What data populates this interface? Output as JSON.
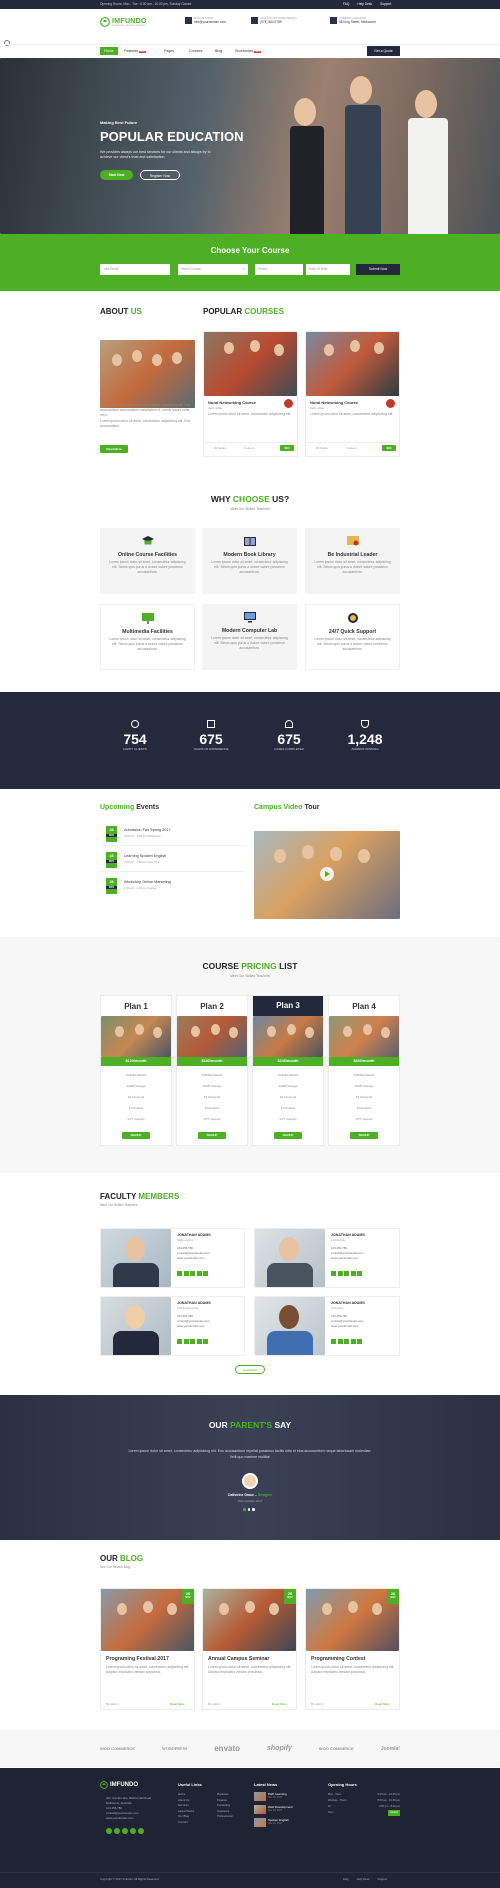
{
  "topbar": {
    "hours": "Opening Hours: Mon - Tue : 6.00 am - 10.00 pm, Sunday Closed",
    "links": [
      "FAQ",
      "Help Desk",
      "Support"
    ]
  },
  "header": {
    "logo": "IMFUNDO",
    "logo_tagline": "EDUCATIONAL UNIVERSITY TEMPLATE",
    "contact": [
      {
        "title": "MAIL US TODAY",
        "value": "info@yourdomain.com"
      },
      {
        "title": "CALL US FOR MORE DETAILS",
        "value": "(974) 564 9789"
      },
      {
        "title": "COMPANY LOCATION",
        "value": "58 King Street, Melbourne"
      }
    ]
  },
  "nav": {
    "items": [
      "Home",
      "Features",
      "Pages",
      "Courses",
      "Blog",
      "Shortcodes"
    ],
    "new_badge": "NEW",
    "cta": "Get a Quote"
  },
  "hero": {
    "kicker": "Making Best Future",
    "title": "POPULAR EDUCATION",
    "text": "We provides always our best services for our clients and always try to achieve our client's trust and satisfaction.",
    "btn1": "Start Now",
    "btn2": "Register Now"
  },
  "choose": {
    "title": "Choose Your Course",
    "fields": [
      "Your Email",
      "Select Course",
      "Phone",
      "Date Of Birth"
    ],
    "submit": "Submit Now"
  },
  "about": {
    "title_a": "ABOUT",
    "title_b": "US",
    "text": "Lorem ipsum dolor sit amet, consectetur adipisicing elit. Eos accusantium accusantium voluptatem ut, omnis ipsum nulla vero.",
    "text2": "Lorem ipsum dolor sit amet, consectetur adipisicing elit. Eos accusantium.",
    "btn": "Read More"
  },
  "popular": {
    "title_a": "POPULAR",
    "title_b": "COURSES",
    "courses": [
      {
        "title": "Nural Networking Course",
        "author": "Jack Jodie",
        "text": "Lorem ipsum dolor sit amet, consectetur adipisicing elit.",
        "students": "20 Seats",
        "duration": "3 Hours",
        "price": "$60"
      },
      {
        "title": "Nural Networking Course",
        "author": "Jack Jodie",
        "text": "Lorem ipsum dolor sit amet, consectetur adipisicing elit.",
        "students": "20 Seats",
        "duration": "3 Hours",
        "price": "$60"
      }
    ]
  },
  "why": {
    "title_a": "WHY",
    "title_b": "CHOOSE",
    "title_c": "US?",
    "sub": "Meet Our Skilled Teachers",
    "items": [
      {
        "icon": "graduation-cap-icon",
        "title": "Online Course Facilities",
        "text": "Lorem ipsum dolor sit amet, consectetur adipiscing elit. Siriuis quis purus a dolore valore possimus accusantium."
      },
      {
        "icon": "book-icon",
        "title": "Modern Book Library",
        "text": "Lorem ipsum dolor sit amet, consectetur adipiscing elit. Siriuis quis purus a dolore valore possimus accusantium."
      },
      {
        "icon": "certificate-icon",
        "title": "Be Industrial Leader",
        "text": "Lorem ipsum dolor sit amet, consectetur adipiscing elit. Siriuis quis purus a dolore valore possimus accusantium."
      },
      {
        "icon": "presentation-icon",
        "title": "Multimedia Facilities",
        "text": "Lorem ipsum dolor sit amet, consectetur adipiscing elit. Siriuis quis purus a dolore valore possimus accusantium."
      },
      {
        "icon": "computer-icon",
        "title": "Modern Computer Lab",
        "text": "Lorem ipsum dolor sit amet, consectetur adipiscing elit. Siriuis quis purus a dolore valore possimus accusantium."
      },
      {
        "icon": "support-icon",
        "title": "24/7 Quick Support",
        "text": "Lorem ipsum dolor sit amet, consectetur adipiscing elit. Siriuis quis purus a dolore valore possimus accusantium."
      }
    ]
  },
  "counters": [
    {
      "icon": "smile-icon",
      "value": "754",
      "label": "HAPPY CLIENTS"
    },
    {
      "icon": "calendar-icon",
      "value": "675",
      "label": "YEARS OF EXPERIENCE"
    },
    {
      "icon": "users-icon",
      "value": "675",
      "label": "CASES COMPLETED"
    },
    {
      "icon": "trophy-icon",
      "value": "1,248",
      "label": "AWARDS WINNING"
    }
  ],
  "events": {
    "title_a": "Upcoming",
    "title_b": "Events",
    "items": [
      {
        "day": "28",
        "month": "NOV",
        "title": "Admission Fair Spring 2017",
        "meta": "2.30 pm - 3.30 pm  Melbourne"
      },
      {
        "day": "28",
        "month": "NOV",
        "title": "Learning Spoken English",
        "meta": "2.30 pm - 3.30 pm  New York"
      },
      {
        "day": "28",
        "month": "NOV",
        "title": "Workshop Online Marketing",
        "meta": "2.30 pm - 3.30 pm  Sydney"
      }
    ]
  },
  "video": {
    "title_a": "Campus Video",
    "title_b": "Tour"
  },
  "pricing": {
    "title_a": "COURSE",
    "title_b": "PRICING",
    "title_c": "LIST",
    "sub": "Meet Our Skilled Teachers",
    "plans": [
      {
        "name": "Plan 1",
        "price": "$120/month",
        "features": [
          "2GB Bandwidth",
          "20GB Storage",
          "16 Accounts",
          "5 Domains",
          "24*7 support"
        ],
        "btn": "SIGNUP"
      },
      {
        "name": "Plan 2",
        "price": "$180/month",
        "features": [
          "2GB Bandwidth",
          "20GB Storage",
          "16 Accounts",
          "5 Domains",
          "24*7 support"
        ],
        "btn": "SIGNUP"
      },
      {
        "name": "Plan 3",
        "price": "$240/month",
        "features": [
          "2GB Bandwidth",
          "20GB Storage",
          "16 Accounts",
          "5 Domains",
          "24*7 support"
        ],
        "btn": "SIGNUP"
      },
      {
        "name": "Plan 4",
        "price": "$330/month",
        "features": [
          "2GB Bandwidth",
          "20GB Storage",
          "16 Accounts",
          "5 Domains",
          "24*7 support"
        ],
        "btn": "SIGNUP"
      }
    ]
  },
  "faculty": {
    "title_a": "FACULTY",
    "title_b": "MEMBERS",
    "sub": "Meet Our Skilled Teachers",
    "members": [
      {
        "name": "JONATHAN ADAMS",
        "role": "Mathematics",
        "phone": "123-456-789",
        "email": "contact@yourdomain.com",
        "web": "www.yourdomain.com"
      },
      {
        "name": "JONATHAN ADAMS",
        "role": "Architecture",
        "phone": "123-456-789",
        "email": "contact@yourdomain.com",
        "web": "www.yourdomain.com"
      },
      {
        "name": "JONATHAN ADAMS",
        "role": "Civil Engineering",
        "phone": "123-456-789",
        "email": "contact@yourdomain.com",
        "web": "www.yourdomain.com"
      },
      {
        "name": "JONATHAN ADAMS",
        "role": "Chemistry",
        "phone": "123-456-789",
        "email": "contact@yourdomain.com",
        "web": "www.yourdomain.com"
      }
    ],
    "btn": "Load More"
  },
  "testimonial": {
    "title_a": "OUR",
    "title_b": "PARENT'S",
    "title_c": "SAY",
    "quote": "Lorem ipsum dolor sit amet, consectetur adipisicing elit. Eos accusantium repellat possimus facilis odio et eius accusantium neque laboriosam molestiae. Velit quo maxime mollitia!",
    "name": "Catherine Grace",
    "role": "Designer",
    "date": "26th October 2017"
  },
  "blog": {
    "title_a": "OUR",
    "title_b": "BLOG",
    "sub": "See Our Recent Blog",
    "posts": [
      {
        "day": "26",
        "month": "NOV",
        "title": "Programing Festival 2017",
        "text": "Lorem ipsum dolor sit amet, consectetur adipisicing elit. Adipisci explicabo veniam possimus.",
        "author": "By admin",
        "more": "Read More"
      },
      {
        "day": "26",
        "month": "NOV",
        "title": "Annual Campus Seminar",
        "text": "Lorem ipsum dolor sit amet, consectetur adipisicing elit. Adipisci explicabo veniam possimus.",
        "author": "By admin",
        "more": "Read More"
      },
      {
        "day": "26",
        "month": "NOV",
        "title": "Programming Contest",
        "text": "Lorem ipsum dolor sit amet, consectetur adipisicing elit. Adipisci explicabo veniam possimus.",
        "author": "By admin",
        "more": "Read More"
      }
    ]
  },
  "partners": [
    "WOO COMMERCE",
    "WORDPRESS",
    "envato",
    "shopify",
    "WOO COMMERCE",
    "Joomla!"
  ],
  "footer": {
    "logo": "IMFUNDO",
    "address": [
      "202, Amelia Lane, Behind Hall Road,",
      "Melbourne, Australia"
    ],
    "phone": "123-456-789",
    "email": "contact@yourdomain.com",
    "web": "www.yourdomain.com",
    "links_title": "Useful Links",
    "links_a": [
      "Home",
      "About Us",
      "Services",
      "Latest Works",
      "Our Blog",
      "Contact"
    ],
    "links_b": [
      "Business",
      "Finance",
      "Consulting",
      "Insurance",
      "Professional"
    ],
    "news_title": "Latest News",
    "news": [
      {
        "title": "PHP Learning",
        "date": "Nov 26, 2017"
      },
      {
        "title": "Web Development",
        "date": "Nov 26, 2017"
      },
      {
        "title": "Spoken English",
        "date": "Nov 26, 2017"
      }
    ],
    "hours_title": "Opening Hours",
    "hours": [
      {
        "day": "Mon - Tues :",
        "time": "6.00 am - 10.00 pm"
      },
      {
        "day": "Wednes - Thurs :",
        "time": "8.00 am - 10.00 pm"
      },
      {
        "day": "Fri :",
        "time": "3.00 pm - 8.00 pm"
      },
      {
        "day": "Sun :",
        "time": "Closed"
      }
    ],
    "copyright": "Copyright © 2017 Imfundo. All Rights Reserved.",
    "bottom_links": [
      "FAQ",
      "Help Desk",
      "Support"
    ]
  }
}
